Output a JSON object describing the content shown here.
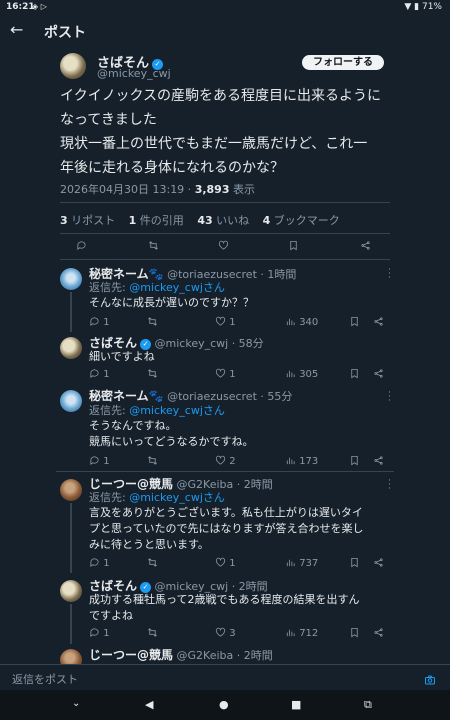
{
  "status_bar": {
    "time": "16:21",
    "battery": "71%"
  },
  "header": {
    "title": "ポスト"
  },
  "post": {
    "author": {
      "display_name": "さばそん",
      "handle": "@mickey_cwj"
    },
    "follow_label": "フォローする",
    "text": [
      "イクイノックスの産駒をある程度目に出来るように",
      "なってきました",
      "現状一番上の世代でもまだ一歳馬だけど、これ一",
      "年後に走れる身体になれるのかな？"
    ],
    "timestamp": "2026年04月30日 13:19 · ",
    "views": "3,893",
    "views_label": " 表示",
    "stats": [
      {
        "count": "3",
        "label": " リポスト"
      },
      {
        "count": "1",
        "label": " 件の引用"
      },
      {
        "count": "43",
        "label": " いいね"
      },
      {
        "count": "4",
        "label": " ブックマーク"
      }
    ]
  },
  "replies": [
    {
      "name": "秘密ネーム🐾",
      "handle": "@toriaezusecret · 1時間",
      "reply_to_label": "返信先: ",
      "reply_to": "@mickey_cwjさん",
      "text": [
        "そんなに成長が遅いのですか？？"
      ],
      "replies": "1",
      "retweets": "",
      "likes": "1",
      "views": "340"
    },
    {
      "name": "さばそん",
      "handle": "@mickey_cwj · 58分",
      "text": [
        "細いですよね"
      ],
      "replies": "1",
      "retweets": "",
      "likes": "1",
      "views": "305"
    },
    {
      "name": "秘密ネーム🐾",
      "handle": "@toriaezusecret · 55分",
      "reply_to_label": "返信先: ",
      "reply_to": "@mickey_cwjさん",
      "text": [
        "そうなんですね。",
        "競馬にいってどうなるかですね。"
      ],
      "replies": "1",
      "retweets": "",
      "likes": "2",
      "views": "173"
    },
    {
      "name": "じーつー@競馬",
      "handle": "@G2Keiba · 2時間",
      "reply_to_label": "返信先: ",
      "reply_to": "@mickey_cwjさん",
      "text": [
        "言及をありがとうございます。私も仕上がりは遅いタイ",
        "プと思っていたので先にはなりますが答え合わせを楽し",
        "みに待とうと思います。"
      ],
      "replies": "1",
      "retweets": "",
      "likes": "1",
      "views": "737"
    },
    {
      "name": "さばそん",
      "handle": "@mickey_cwj · 2時間",
      "text": [
        "成功する種牡馬って2歳戦でもある程度の結果を出すん",
        "ですよね"
      ],
      "replies": "1",
      "retweets": "",
      "likes": "3",
      "views": "712"
    },
    {
      "name": "じーつー@競馬",
      "handle": "@G2Keiba · 2時間"
    }
  ],
  "reply_bar": {
    "placeholder": "返信をポスト"
  },
  "colors": {
    "background": "#15202b",
    "accent": "#1d9bf0",
    "muted": "#8b98a5",
    "divider": "#38444d"
  }
}
